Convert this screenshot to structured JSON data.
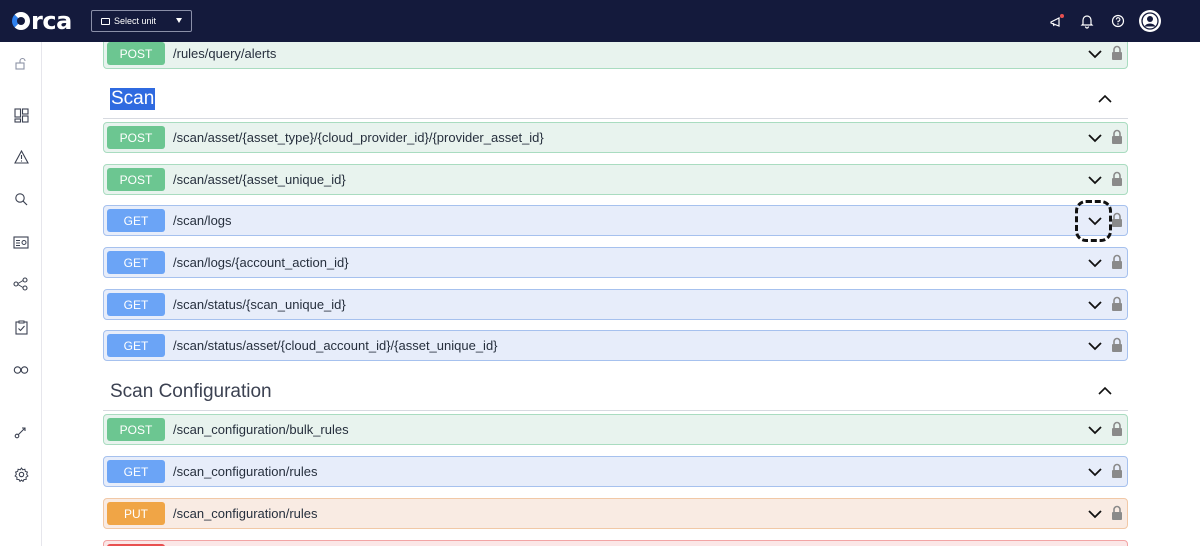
{
  "topbar": {
    "logo_text": "rca",
    "unit_select_label": "Select unit",
    "icons": [
      "megaphone-icon",
      "bell-icon",
      "help-icon",
      "user-avatar-icon"
    ],
    "notification_dot_color": "#e85050"
  },
  "sidebar": {
    "items": [
      "unlock-icon",
      "dashboard-icon",
      "alert-icon",
      "search-icon",
      "inventory-icon",
      "graph-icon",
      "compliance-icon",
      "integrations-icon",
      "shift-left-icon",
      "settings-icon"
    ]
  },
  "operations": {
    "o0": {
      "method": "POST",
      "path": "/rules/query/alerts"
    },
    "o1": {
      "method": "POST",
      "path": "/scan/asset/{asset_type}/{cloud_provider_id}/{provider_asset_id}"
    },
    "o2": {
      "method": "POST",
      "path": "/scan/asset/{asset_unique_id}"
    },
    "o3": {
      "method": "GET",
      "path": "/scan/logs"
    },
    "o4": {
      "method": "GET",
      "path": "/scan/logs/{account_action_id}"
    },
    "o5": {
      "method": "GET",
      "path": "/scan/status/{scan_unique_id}"
    },
    "o6": {
      "method": "GET",
      "path": "/scan/status/asset/{cloud_account_id}/{asset_unique_id}"
    },
    "o7": {
      "method": "POST",
      "path": "/scan_configuration/bulk_rules"
    },
    "o8": {
      "method": "GET",
      "path": "/scan_configuration/rules"
    },
    "o9": {
      "method": "PUT",
      "path": "/scan_configuration/rules"
    }
  },
  "sections": {
    "scan": {
      "title": "Scan"
    },
    "scan_configuration": {
      "title": "Scan Configuration"
    }
  },
  "colors": {
    "topbar_bg": "#141a3c",
    "post": "#6cc691",
    "get": "#6ba4f6",
    "put": "#f0a546",
    "delete": "#e85050",
    "highlight": "#2f6ae0"
  }
}
